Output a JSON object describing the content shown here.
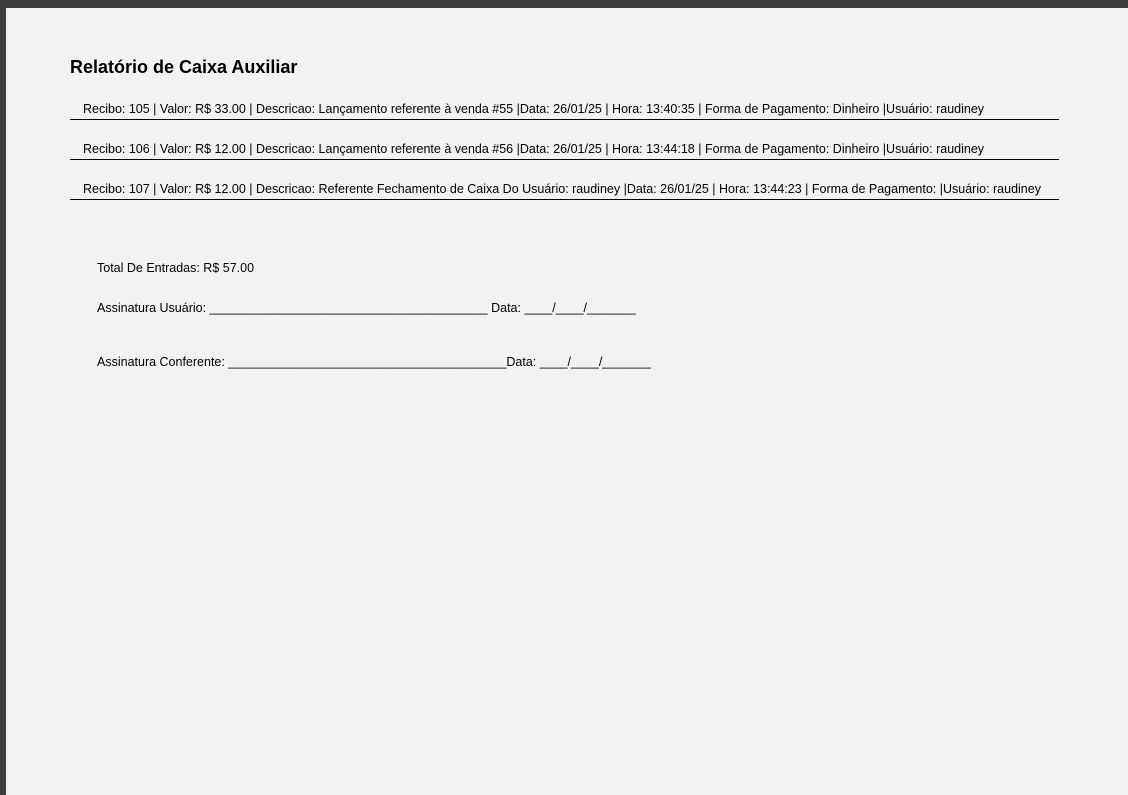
{
  "report": {
    "title": "Relatório de Caixa Auxiliar",
    "entries": [
      "Recibo: 105 | Valor: R$ 33.00 | Descricao: Lançamento referente à venda #55 |Data: 26/01/25 | Hora: 13:40:35 | Forma de Pagamento: Dinheiro  |Usuário: raudiney",
      "Recibo: 106 | Valor: R$ 12.00 | Descricao: Lançamento referente à venda #56 |Data: 26/01/25 | Hora: 13:44:18 | Forma de Pagamento: Dinheiro  |Usuário: raudiney",
      "Recibo: 107 | Valor: R$ 12.00 | Descricao: Referente Fechamento de Caixa Do Usuário: raudiney |Data: 26/01/25 | Hora: 13:44:23 | Forma de Pagamento:   |Usuário: raudiney"
    ],
    "total": "Total De Entradas: R$ 57.00",
    "signature_user": "Assinatura Usuário: ________________________________________ Data: ____/____/_______",
    "signature_checker": "Assinatura Conferente: ________________________________________Data: ____/____/_______"
  }
}
